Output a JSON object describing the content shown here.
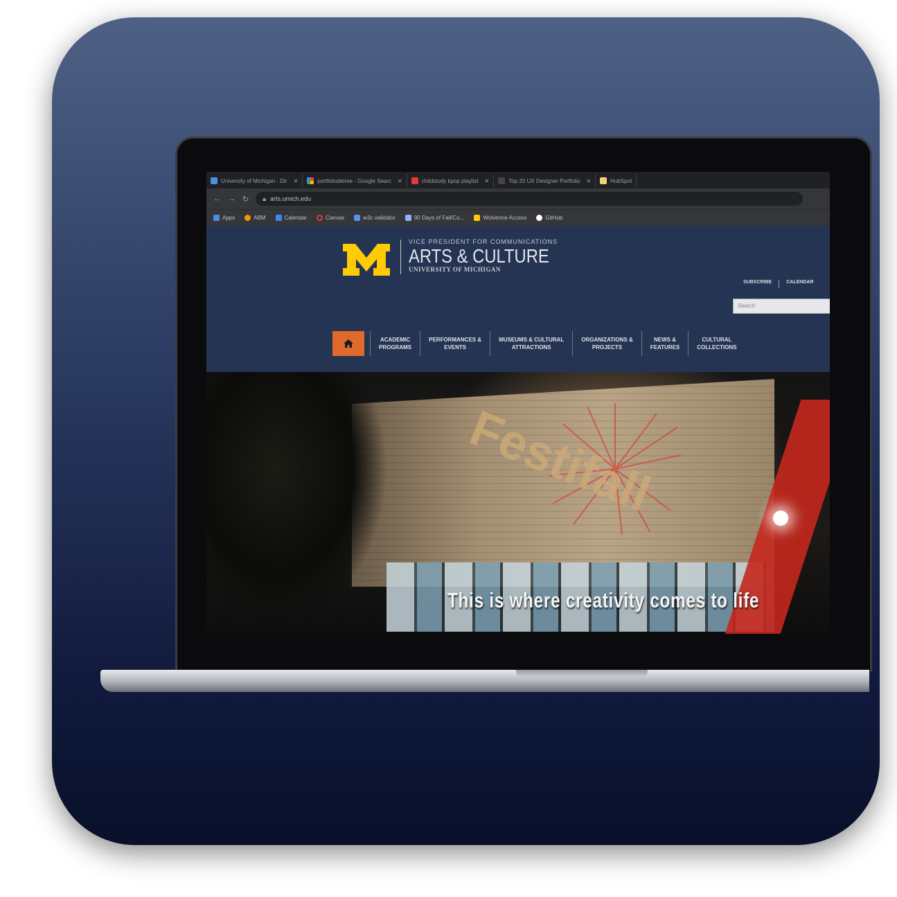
{
  "browser": {
    "tabs": [
      {
        "label": "University of Michigan - Dir",
        "color": "#4a90e2"
      },
      {
        "label": "portfoliodeiree - Google Searc",
        "color": "#ea4335"
      },
      {
        "label": "childstudy kpop playlist",
        "color": "#e53935"
      },
      {
        "label": "Top 20 UX Designer Portfolio",
        "color": "#444"
      },
      {
        "label": "HubSpot",
        "color": "#f4d27a"
      }
    ],
    "url": "arts.umich.edu",
    "bookmarks": [
      {
        "label": "Apps",
        "color": "#4a90e2"
      },
      {
        "label": "ABM",
        "color": "#f29900"
      },
      {
        "label": "Calendar",
        "color": "#4285f4"
      },
      {
        "label": "Canvas",
        "color": "#e53935"
      },
      {
        "label": "w3c validator",
        "color": "#5c8df6"
      },
      {
        "label": "90 Days of Fall/Co...",
        "color": "#8ab4f8"
      },
      {
        "label": "Wolverine Access",
        "color": "#ffcb05"
      },
      {
        "label": "GitHub",
        "color": "#ffffff"
      }
    ]
  },
  "site": {
    "logo_top": "VICE PRESIDENT FOR COMMUNICATIONS",
    "logo_main": "ARTS & CULTURE",
    "logo_sub": "UNIVERSITY OF MICHIGAN",
    "utility": [
      "SUBSCRIBE",
      "CALENDAR"
    ],
    "search_placeholder": "Search",
    "nav": [
      {
        "line1": "ACADEMIC",
        "line2": "PROGRAMS"
      },
      {
        "line1": "PERFORMANCES &",
        "line2": "EVENTS"
      },
      {
        "line1": "MUSEUMS & CULTURAL",
        "line2": "ATTRACTIONS"
      },
      {
        "line1": "ORGANIZATIONS &",
        "line2": "PROJECTS"
      },
      {
        "line1": "NEWS &",
        "line2": "FEATURES"
      },
      {
        "line1": "CULTURAL",
        "line2": "COLLECTIONS"
      }
    ],
    "hero_text": "This is where creativity comes to life",
    "hero_sign": "Festifall"
  },
  "colors": {
    "maize": "#ffcb05",
    "blue": "#243452",
    "home_button": "#e06a2c"
  }
}
